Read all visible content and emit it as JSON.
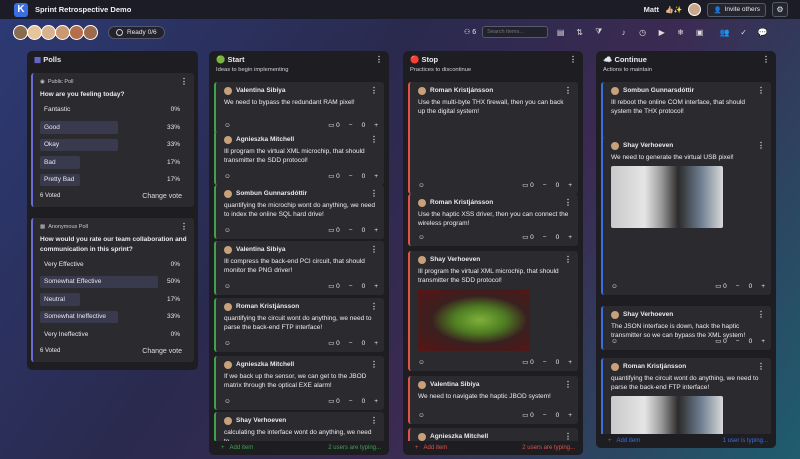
{
  "app": {
    "title": "Sprint Retrospective Demo",
    "logo": "K"
  },
  "user": {
    "name": "Matt",
    "emoji": "👍🏼✨",
    "invite": "Invite others"
  },
  "status": {
    "ready": "Ready 0/6",
    "participants": "6"
  },
  "search": {
    "placeholder": "Search items..."
  },
  "colors": {
    "polls": "#6a6ad8",
    "start": "#3fa34d",
    "stop": "#e0524a",
    "continue": "#3b6fe0"
  },
  "polls": {
    "title": "Polls",
    "list": [
      {
        "type": "Public Poll",
        "question": "How are you feeling today?",
        "options": [
          {
            "label": "Fantastic",
            "pct": "0%",
            "fill": 0
          },
          {
            "label": "Good",
            "pct": "33%",
            "fill": 33
          },
          {
            "label": "Okay",
            "pct": "33%",
            "fill": 33
          },
          {
            "label": "Bad",
            "pct": "17%",
            "fill": 17
          },
          {
            "label": "Pretty Bad",
            "pct": "17%",
            "fill": 17
          }
        ],
        "voted": "6 Voted",
        "change": "Change vote"
      },
      {
        "type": "Anonymous Poll",
        "question": "How would you rate our team collaboration and communication in this sprint?",
        "options": [
          {
            "label": "Very Effective",
            "pct": "0%",
            "fill": 0
          },
          {
            "label": "Somewhat Effective",
            "pct": "50%",
            "fill": 50
          },
          {
            "label": "Neutral",
            "pct": "17%",
            "fill": 17
          },
          {
            "label": "Somewhat Ineffective",
            "pct": "33%",
            "fill": 33
          },
          {
            "label": "Very Ineffective",
            "pct": "0%",
            "fill": 0
          }
        ],
        "voted": "6 Voted",
        "change": "Change vote"
      }
    ]
  },
  "columns": [
    {
      "key": "start",
      "icon": "🟢",
      "title": "Start",
      "subtitle": "Ideas to begin implementing",
      "typing": "2 users are typing...",
      "add": "Add item",
      "cards": [
        {
          "author": "Valentina Sibiya",
          "text": "We need to bypass the redundant RAM pixel!",
          "comments": "0",
          "votes": "0"
        },
        {
          "author": "Agnieszka Mitchell",
          "text": "Ill program the virtual XML microchip, that should transmitter the SDD protocol!",
          "comments": "0",
          "votes": "0"
        },
        {
          "author": "Sombun Gunnarsdóttir",
          "text": "quantifying the microchip wont do anything, we need to index the online SQL hard drive!",
          "comments": "0",
          "votes": "0"
        },
        {
          "author": "Valentina Sibiya",
          "text": "Ill compress the back-end PCI circuit, that should monitor the PNG driver!",
          "comments": "0",
          "votes": "0"
        },
        {
          "author": "Roman Kristjánsson",
          "text": "quantifying the circuit wont do anything, we need to parse the back-end FTP interface!",
          "comments": "0",
          "votes": "0"
        },
        {
          "author": "Agnieszka Mitchell",
          "text": "If we back up the sensor, we can get to the JBOD matrix through the optical EXE alarm!",
          "comments": "0",
          "votes": "0"
        },
        {
          "author": "Shay Verhoeven",
          "text": "calculating the interface wont do anything, we need to",
          "comments": "0",
          "votes": "0"
        }
      ]
    },
    {
      "key": "stop",
      "icon": "🔴",
      "title": "Stop",
      "subtitle": "Practices to discontinue",
      "typing": "2 users are typing...",
      "add": "Add item",
      "cards": [
        {
          "author": "Roman Kristjánsson",
          "text": "Use the multi-byte THX firewall, then you can back up the digital system!",
          "comments": "0",
          "votes": "0"
        },
        {
          "author": "Roman Kristjánsson",
          "text": "Use the haptic XSS driver, then you can connect the wireless program!",
          "comments": "0",
          "votes": "0"
        },
        {
          "author": "Shay Verhoeven",
          "text": "Ill program the virtual XML microchip, that should transmitter the SDD protocol!",
          "comments": "0",
          "votes": "0"
        },
        {
          "author": "Valentina Sibiya",
          "text": "We need to navigate the haptic JBOD system!",
          "comments": "0",
          "votes": "0"
        },
        {
          "author": "Agnieszka Mitchell",
          "text": "",
          "comments": "0",
          "votes": "0"
        }
      ]
    },
    {
      "key": "continue",
      "icon": "☁️",
      "title": "Continue",
      "subtitle": "Actions to maintain",
      "typing": "1 user is typing...",
      "add": "Add item",
      "cards": [
        {
          "author": "Sombun Gunnarsdóttir",
          "text": "Ill reboot the online COM interface, that should system the THX protocol!",
          "comments": "0",
          "votes": "0"
        },
        {
          "author": "Shay Verhoeven",
          "text": "We need to generate the virtual USB pixel!",
          "comments": "0",
          "votes": "0"
        },
        {
          "author": "Shay Verhoeven",
          "text": "The JSON interface is down, hack the haptic transmitter so we can bypass the XML system!",
          "comments": "0",
          "votes": "0"
        },
        {
          "author": "Roman Kristjánsson",
          "text": "quantifying the circuit wont do anything, we need to parse the back-end FTP interface!",
          "comments": "0",
          "votes": "0"
        }
      ]
    }
  ]
}
